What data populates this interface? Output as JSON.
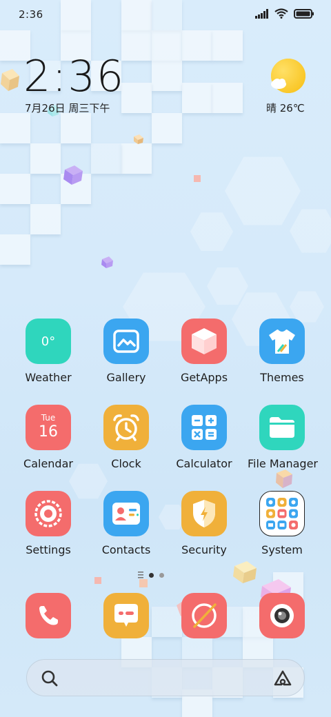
{
  "status_bar": {
    "time": "2:36",
    "icons": [
      "signal-icon",
      "wifi-icon",
      "battery-icon"
    ]
  },
  "clock_widget": {
    "time": "2:36",
    "date": "7月26日 周三下午"
  },
  "weather_widget": {
    "icon": "sun-cloud-icon",
    "text": "晴 26℃"
  },
  "apps": [
    {
      "label": "Weather",
      "icon": "weather-icon",
      "color": "#2fd6bd",
      "inner": "0°"
    },
    {
      "label": "Gallery",
      "icon": "gallery-icon",
      "color": "#3ba6f0"
    },
    {
      "label": "GetApps",
      "icon": "getapps-icon",
      "color": "#f46c6c"
    },
    {
      "label": "Themes",
      "icon": "themes-icon",
      "color": "#3ba6f0"
    },
    {
      "label": "Calendar",
      "icon": "calendar-icon",
      "color": "#f46c6c",
      "inner_top": "Tue",
      "inner_num": "16"
    },
    {
      "label": "Clock",
      "icon": "clock-icon",
      "color": "#f0b03a"
    },
    {
      "label": "Calculator",
      "icon": "calculator-icon",
      "color": "#3ba6f0"
    },
    {
      "label": "File Manager",
      "icon": "folder-icon",
      "color": "#2fd6bd"
    },
    {
      "label": "Settings",
      "icon": "settings-icon",
      "color": "#f46c6c"
    },
    {
      "label": "Contacts",
      "icon": "contacts-icon",
      "color": "#3ba6f0"
    },
    {
      "label": "Security",
      "icon": "security-icon",
      "color": "#f0b03a"
    },
    {
      "label": "System",
      "icon": "system-folder-icon",
      "color": "#ffffff"
    }
  ],
  "page_indicator": {
    "pages": 2,
    "current": 1
  },
  "dock": [
    {
      "icon": "phone-icon",
      "color": "#f46c6c"
    },
    {
      "icon": "messaging-icon",
      "color": "#f0b03a"
    },
    {
      "icon": "browser-icon",
      "color": "#f46c6c"
    },
    {
      "icon": "camera-icon",
      "color": "#f46c6c"
    }
  ],
  "search": {
    "placeholder": ""
  }
}
